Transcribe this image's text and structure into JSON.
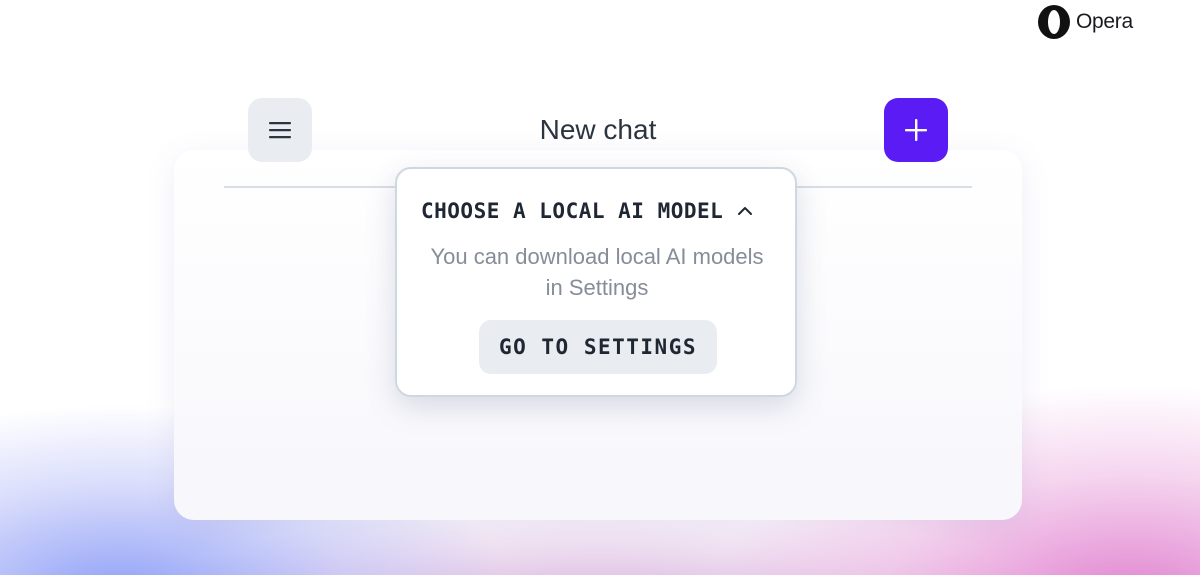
{
  "brand": {
    "logo_icon": "opera-logo-icon",
    "name": "Opera"
  },
  "header": {
    "title": "New chat",
    "menu_icon": "hamburger-menu-icon",
    "new_chat_icon": "plus-icon"
  },
  "model_picker": {
    "title": "CHOOSE A LOCAL AI MODEL",
    "toggle_icon": "chevron-up-icon",
    "description": "You can download local AI models in Settings",
    "settings_button_label": "GO TO SETTINGS"
  },
  "colors": {
    "accent": "#5b1bf5",
    "button_gray": "#e9edf1",
    "text_dark": "#1f2733",
    "text_muted": "#868d98"
  }
}
